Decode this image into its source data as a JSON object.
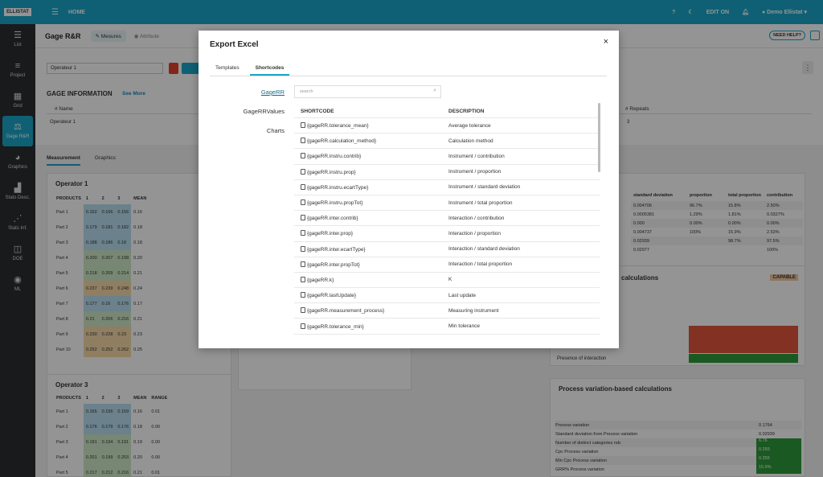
{
  "topbar": {
    "logo": "ELLISTAT",
    "home": "HOME",
    "help": "?",
    "edit": "EDIT ON",
    "user": "Demo Ellistat"
  },
  "sidebar": [
    {
      "label": "List",
      "icon": "list-icon",
      "glyph": "☰"
    },
    {
      "label": "Project",
      "icon": "project-icon",
      "glyph": "≡"
    },
    {
      "label": "Grid",
      "icon": "grid-icon",
      "glyph": "▦"
    },
    {
      "label": "Gage R&R",
      "icon": "scale-icon",
      "glyph": "⚖"
    },
    {
      "label": "Graphics",
      "icon": "pie-icon",
      "glyph": "◕"
    },
    {
      "label": "Stats Desc.",
      "icon": "chart-icon",
      "glyph": "▟"
    },
    {
      "label": "Stats Inf.",
      "icon": "scatter-icon",
      "glyph": "⋰"
    },
    {
      "label": "DOE",
      "icon": "doe-icon",
      "glyph": "◫"
    },
    {
      "label": "ML",
      "icon": "brain-icon",
      "glyph": "◉"
    }
  ],
  "page": {
    "title": "Gage R&R",
    "tab_measures": "Mesures",
    "tab_attribute": "Attribute",
    "need_help": "NEED HELP?",
    "filter": "Operateur 1",
    "info_title": "GAGE INFORMATION",
    "see_more": "See More",
    "col_name": "Name",
    "col_repeats": "Repeats",
    "row_name": "Operateur 1",
    "row_repeats": "3",
    "tab_measurement": "Measurement",
    "tab_graphics": "Graphics"
  },
  "operator1": {
    "title": "Operator 1",
    "headers": [
      "PRODUCTS",
      "1",
      "2",
      "3",
      "MEAN"
    ],
    "rows": [
      [
        "Part 1",
        "0.162",
        "0.166",
        "0.156",
        "0.16"
      ],
      [
        "Part 2",
        "0.179",
        "0.181",
        "0.182",
        "0.18"
      ],
      [
        "Part 3",
        "0.188",
        "0.186",
        "0.18",
        "0.18"
      ],
      [
        "Part 4",
        "0.200",
        "0.207",
        "0.198",
        "0.20"
      ],
      [
        "Part 5",
        "0.218",
        "0.209",
        "0.214",
        "0.21"
      ],
      [
        "Part 6",
        "0.237",
        "0.239",
        "0.248",
        "0.24"
      ],
      [
        "Part 7",
        "0.177",
        "0.16",
        "0.176",
        "0.17"
      ],
      [
        "Part 8",
        "0.21",
        "0.206",
        "0.216",
        "0.21"
      ],
      [
        "Part 9",
        "0.230",
        "0.228",
        "0.23",
        "0.23"
      ],
      [
        "Part 10",
        "0.252",
        "0.252",
        "0.262",
        "0.25"
      ]
    ]
  },
  "operator3": {
    "title": "Operator 3",
    "headers": [
      "PRODUCTS",
      "1",
      "2",
      "3",
      "MEAN",
      "RANGE"
    ],
    "rows": [
      [
        "Part 1",
        "0.165",
        "0.156",
        "0.159",
        "0.16",
        "0.01"
      ],
      [
        "Part 2",
        "0.176",
        "0.179",
        "0.176",
        "0.18",
        "0.00"
      ],
      [
        "Part 3",
        "0.191",
        "0.194",
        "0.191",
        "0.19",
        "0.00"
      ],
      [
        "Part 4",
        "0.201",
        "0.199",
        "0.203",
        "0.20",
        "0.00"
      ],
      [
        "Part 5",
        "0.217",
        "0.212",
        "0.216",
        "0.21",
        "0.01"
      ]
    ]
  },
  "right_panel": {
    "headers": [
      "standard deviation",
      "proportion",
      "total proportion",
      "contribution"
    ],
    "rows": [
      [
        "0.004706",
        "96.7%",
        "15.8%",
        "2.50%"
      ],
      [
        "0.0005381",
        "1.29%",
        "1.81%",
        "0.0327%"
      ],
      [
        "0.000",
        "0.00%",
        "0.00%",
        "0.00%"
      ],
      [
        "0.004737",
        "100%",
        "15.9%",
        "2.53%"
      ],
      [
        "0.02939",
        "",
        "98.7%",
        "97.5%"
      ],
      [
        "0.02977",
        "",
        "",
        "100%"
      ]
    ],
    "calc_title": "calculations",
    "capable": "CAPABLE",
    "presence": "Presence of interaction",
    "proc_title": "Process variation-based calculations",
    "proc_rows": [
      [
        "Process variation",
        "0.1764"
      ],
      [
        "Standard deviation from Process variation",
        "0.02939"
      ],
      [
        "Number of distinct categories ndc",
        "6.76"
      ],
      [
        "Cpc Process variation",
        "0.255"
      ],
      [
        "Min Cpc Process variation",
        "0.255"
      ],
      [
        "GRR% Process variation",
        "15.9%"
      ]
    ]
  },
  "modal": {
    "title": "Export Excel",
    "close": "×",
    "tabs": [
      "Templates",
      "Shortcodes"
    ],
    "categories": [
      "GageRR",
      "GageRRValues",
      "Charts"
    ],
    "search_placeholder": "search",
    "col_shortcode": "SHORTCODE",
    "col_description": "DESCRIPTION",
    "rows": [
      [
        "{gageRR.tolerance_mean}",
        "Average tolerance"
      ],
      [
        "{gageRR.calculation_method}",
        "Calculation method"
      ],
      [
        "{gageRR.instru.contrib}",
        "Instrument / contribution"
      ],
      [
        "{gageRR.instru.prop}",
        "Instrument / proportion"
      ],
      [
        "{gageRR.instru.ecartType}",
        "Instrument / standard deviation"
      ],
      [
        "{gageRR.instru.propTot}",
        "Instrument / total proportion"
      ],
      [
        "{gageRR.inter.contrib}",
        "Interaction / contribution"
      ],
      [
        "{gageRR.inter.prop}",
        "Interaction / proportion"
      ],
      [
        "{gageRR.inter.ecartType}",
        "Interaction / standard deviation"
      ],
      [
        "{gageRR.inter.propTot}",
        "Interaction / total proportion"
      ],
      [
        "{gageRR.k}",
        "K"
      ],
      [
        "{gageRR.lastUpdate}",
        "Last update"
      ],
      [
        "{gageRR.measurement_process}",
        "Measuring instrument"
      ],
      [
        "{gageRR.tolerance_min}",
        "Min tolerance"
      ]
    ]
  },
  "colors": {
    "accent": "#1aa6c8",
    "sidebar": "#2b2e30",
    "capable": "#f3c9a0",
    "red_cell": "#e0553b",
    "green_cell": "#2e9a3a"
  }
}
